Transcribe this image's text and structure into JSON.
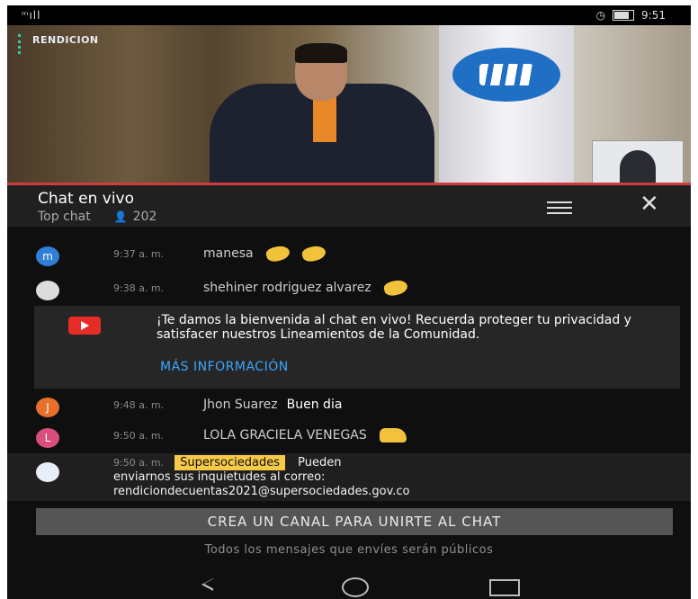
{
  "status_bar": {
    "signal": "ᵐıll",
    "time": "9:51"
  },
  "video": {
    "logo_text": "RENDICION"
  },
  "chat_header": {
    "title": "Chat en vivo",
    "mode": "Top chat",
    "viewers": "202"
  },
  "messages": [
    {
      "avatar_letter": "m",
      "avatar_color": "#2f7fd6",
      "time": "9:37 a. m.",
      "author": "manesa",
      "text": "",
      "emoji": "clap x2"
    },
    {
      "avatar_letter": "",
      "avatar_color": "#dcdcdc",
      "time": "9:38 a. m.",
      "author": "shehiner rodriguez alvarez",
      "text": "",
      "emoji": "clap"
    },
    {
      "avatar_letter": "J",
      "avatar_color": "#e8702c",
      "time": "9:48 a. m.",
      "author": "Jhon Suarez",
      "text": "Buen dia",
      "emoji": ""
    },
    {
      "avatar_letter": "L",
      "avatar_color": "#d84f7d",
      "time": "9:50 a. m.",
      "author": "LOLA GRACIELA VENEGAS",
      "text": "",
      "emoji": "thumbs-up"
    }
  ],
  "welcome": {
    "text": "¡Te damos la bienvenida al chat en vivo! Recuerda proteger tu privacidad y satisfacer nuestros Lineamientos de la Comunidad.",
    "link": "MÁS INFORMACIÓN"
  },
  "pinned": {
    "time": "9:50 a. m.",
    "badge": "Supersociedades",
    "line1": "Pueden",
    "line2": "enviarnos sus inquietudes al correo:",
    "line3": "rendiciondecuentas2021@supersociedades.gov.co"
  },
  "footer": {
    "create_button": "CREA UN CANAL PARA UNIRTE AL CHAT",
    "note": "Todos los mensajes que envíes serán públicos"
  }
}
